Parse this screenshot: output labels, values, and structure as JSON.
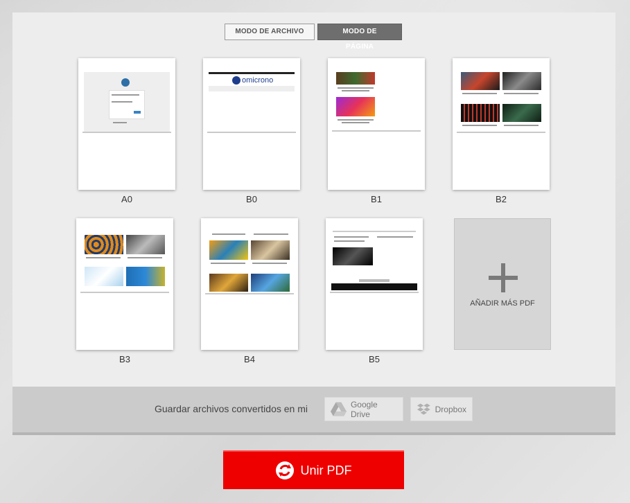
{
  "mode_toggle": {
    "file_mode_label": "MODO DE ARCHIVO",
    "page_mode_label": "MODO DE PÁGINA",
    "active": "page"
  },
  "pages": [
    {
      "label": "A0"
    },
    {
      "label": "B0"
    },
    {
      "label": "B1"
    },
    {
      "label": "B2"
    },
    {
      "label": "B3"
    },
    {
      "label": "B4"
    },
    {
      "label": "B5"
    }
  ],
  "thumb_b0_logo_text": "omicrono",
  "add_more": {
    "label": "AÑADIR MÁS PDF",
    "icon": "plus-icon"
  },
  "save_bar": {
    "prompt": "Guardar archivos convertidos en mi",
    "google_drive_label": "Google Drive",
    "dropbox_label": "Dropbox"
  },
  "merge_button": {
    "label": "Unir PDF",
    "icon": "merge-icon"
  },
  "colors": {
    "accent_red": "#ee0000",
    "active_mode": "#6e6e6e"
  }
}
